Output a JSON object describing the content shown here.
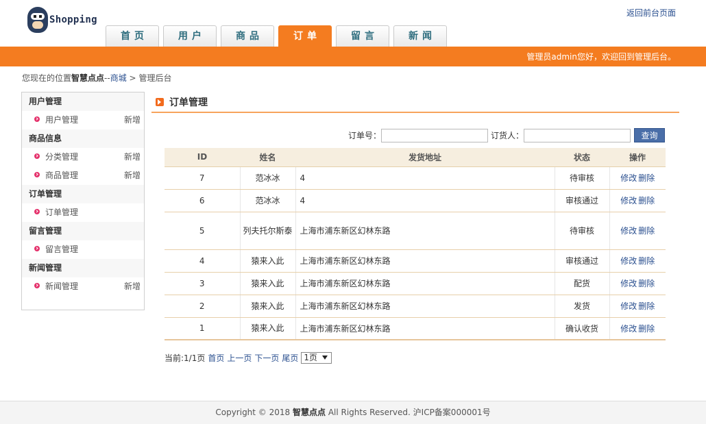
{
  "header": {
    "logo_text": "Shopping",
    "front_link": "返回前台页面",
    "nav": [
      "首页",
      "用户",
      "商品",
      "订单",
      "留言",
      "新闻"
    ],
    "active_tab": "订单",
    "welcome": "管理员admin您好，欢迎回到管理后台。",
    "colors": {
      "accent": "#f47c20",
      "link": "#2a4f8f"
    }
  },
  "breadcrumb": {
    "prefix": "您现在的位置",
    "brand": "智慧点点",
    "dash": "--",
    "mall": "商城",
    "separator": ">",
    "current": "管理后台"
  },
  "sidebar": {
    "groups": [
      {
        "title": "用户管理",
        "items": [
          {
            "label": "用户管理",
            "add": "新增"
          }
        ]
      },
      {
        "title": "商品信息",
        "items": [
          {
            "label": "分类管理",
            "add": "新增"
          },
          {
            "label": "商品管理",
            "add": "新增"
          }
        ]
      },
      {
        "title": "订单管理",
        "items": [
          {
            "label": "订单管理",
            "add": ""
          }
        ]
      },
      {
        "title": "留言管理",
        "items": [
          {
            "label": "留言管理",
            "add": ""
          }
        ]
      },
      {
        "title": "新闻管理",
        "items": [
          {
            "label": "新闻管理",
            "add": "新增"
          }
        ]
      }
    ]
  },
  "main": {
    "title": "订单管理",
    "title_icon": "arrow-right-icon",
    "search": {
      "order_label": "订单号：",
      "order_value": "",
      "buyer_label": "订货人：",
      "buyer_value": "",
      "button": "查询"
    },
    "table": {
      "columns": [
        "ID",
        "姓名",
        "发货地址",
        "状态",
        "操作"
      ],
      "rows": [
        {
          "id": "7",
          "name": "范冰冰",
          "address": "4",
          "status": "待审核"
        },
        {
          "id": "6",
          "name": "范冰冰",
          "address": "4",
          "status": "审核通过"
        },
        {
          "id": "5",
          "name": "列夫托尔斯泰",
          "address": "上海市浦东新区幻林东路",
          "status": "待审核"
        },
        {
          "id": "4",
          "name": "猿来入此",
          "address": "上海市浦东新区幻林东路",
          "status": "审核通过"
        },
        {
          "id": "3",
          "name": "猿来入此",
          "address": "上海市浦东新区幻林东路",
          "status": "配货"
        },
        {
          "id": "2",
          "name": "猿来入此",
          "address": "上海市浦东新区幻林东路",
          "status": "发货"
        },
        {
          "id": "1",
          "name": "猿来入此",
          "address": "上海市浦东新区幻林东路",
          "status": "确认收货"
        }
      ],
      "edit_label": "修改",
      "delete_label": "删除"
    },
    "pager": {
      "current": "当前:1/1页",
      "first": "首页",
      "prev": "上一页",
      "next": "下一页",
      "last": "尾页",
      "select_value": "1页"
    }
  },
  "footer": {
    "before": "Copyright © 2018 ",
    "brand": "智慧点点",
    "after": " All Rights Reserved. 沪ICP备案000001号"
  }
}
